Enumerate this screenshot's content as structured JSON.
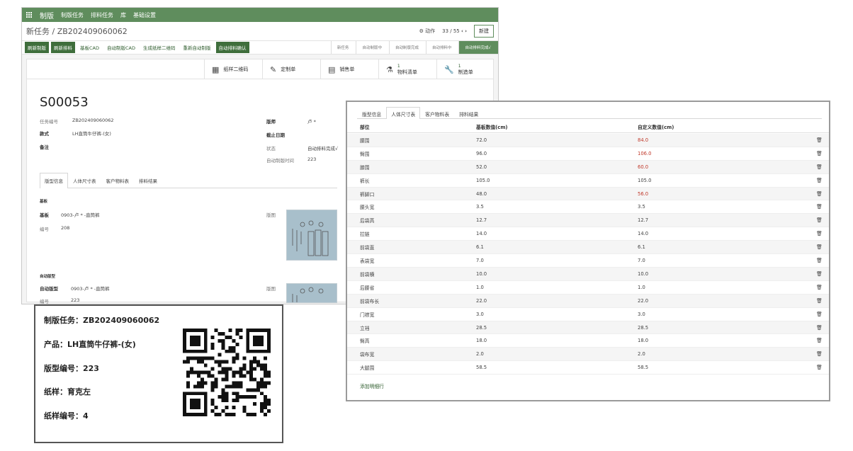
{
  "main": {
    "topbar": {
      "brand": "制版",
      "menus": [
        "制版任务",
        "排料任务",
        "库",
        "基础设置"
      ]
    },
    "title": "新任务 / ZB202409060062",
    "actions_label": "动作",
    "pager": "33 / 55",
    "new_label": "新建",
    "buttons": {
      "refresh_plate": "刷新制版",
      "refresh_layout": "刷新排料",
      "base_cad": "基板CAD",
      "auto_cad": "自动制版CAD",
      "gen_qr": "生成纸样二维码",
      "redo_auto": "重新自动制版",
      "confirm_layout": "自动排料确认"
    },
    "stages": [
      "新任务",
      "自动制版中",
      "自动制版完成",
      "自动排料中",
      "自动排料完成√"
    ],
    "smart_buttons": {
      "qr": "纸样二维码",
      "custom": "定制单",
      "sales": "销售单",
      "materials_count": "1",
      "materials": "物料清单",
      "mo_count": "1",
      "mo": "制造单"
    },
    "record": {
      "name": "S00053",
      "task_no_label": "任务编号",
      "task_no": "ZB202409060062",
      "style_label": "款式",
      "style": "LH直筒牛仔裤-(女)",
      "note_label": "备注",
      "version_label": "版师",
      "version": "卢 *",
      "deadline_label": "截止日期",
      "status_label": "状态",
      "status": "自动排料完成√",
      "auto_time_label": "自动制版时间",
      "auto_time": "223"
    },
    "tabs": [
      "版型信息",
      "人体尺寸表",
      "客户物料表",
      "排料结果"
    ],
    "base_section": {
      "heading": "基板",
      "base_label": "基板",
      "base_value": "0903-卢 * -直筒裤",
      "no_label": "编号",
      "no_value": "208",
      "pattern_label": "版图"
    },
    "auto_section": {
      "heading": "自动版型",
      "auto_label": "自动版型",
      "auto_value": "0903-卢 * -直筒裤",
      "no_label": "编号",
      "no_value": "223",
      "pattern_label": "版图"
    }
  },
  "qr_card": {
    "task": "制版任务：ZB202409060062",
    "product": "产品：LH直筒牛仔裤-(女)",
    "pattern_no": "版型编号：223",
    "sample": "纸样：育克左",
    "sample_no": "纸样编号：4"
  },
  "size_table": {
    "tabs": [
      "版型信息",
      "人体尺寸表",
      "客户物料表",
      "排料结果"
    ],
    "active_tab": 1,
    "headers": [
      "部位",
      "基板数值(cm)",
      "自定义数值(cm)"
    ],
    "rows": [
      {
        "part": "腰围",
        "base": "72.0",
        "custom": "84.0",
        "changed": true
      },
      {
        "part": "臀围",
        "base": "96.0",
        "custom": "106.0",
        "changed": true
      },
      {
        "part": "膝围",
        "base": "52.0",
        "custom": "60.0",
        "changed": true
      },
      {
        "part": "裤长",
        "base": "105.0",
        "custom": "105.0",
        "changed": false
      },
      {
        "part": "裤脚口",
        "base": "48.0",
        "custom": "56.0",
        "changed": true
      },
      {
        "part": "腰头宽",
        "base": "3.5",
        "custom": "3.5",
        "changed": false
      },
      {
        "part": "后袋高",
        "base": "12.7",
        "custom": "12.7",
        "changed": false
      },
      {
        "part": "拉链",
        "base": "14.0",
        "custom": "14.0",
        "changed": false
      },
      {
        "part": "前袋直",
        "base": "6.1",
        "custom": "6.1",
        "changed": false
      },
      {
        "part": "表袋宽",
        "base": "7.0",
        "custom": "7.0",
        "changed": false
      },
      {
        "part": "前袋横",
        "base": "10.0",
        "custom": "10.0",
        "changed": false
      },
      {
        "part": "后腰省",
        "base": "1.0",
        "custom": "1.0",
        "changed": false
      },
      {
        "part": "前袋布长",
        "base": "22.0",
        "custom": "22.0",
        "changed": false
      },
      {
        "part": "门襟宽",
        "base": "3.0",
        "custom": "3.0",
        "changed": false
      },
      {
        "part": "立裆",
        "base": "28.5",
        "custom": "28.5",
        "changed": false
      },
      {
        "part": "臀高",
        "base": "18.0",
        "custom": "18.0",
        "changed": false
      },
      {
        "part": "袋布宽",
        "base": "2.0",
        "custom": "2.0",
        "changed": false
      },
      {
        "part": "大腿围",
        "base": "58.5",
        "custom": "58.5",
        "changed": false
      }
    ],
    "add_row": "添加明细行"
  },
  "colors": {
    "brand": "#5f8d5d",
    "brand_dark": "#3f6e3c",
    "changed_value": "#c0392b"
  },
  "icons": {
    "grid": "apps-grid-icon",
    "gear": "gear-icon",
    "qr": "qr-code-icon",
    "edit": "edit-icon",
    "list": "list-icon",
    "flask": "flask-icon",
    "wrench": "wrench-icon",
    "trash": "trash-icon"
  }
}
